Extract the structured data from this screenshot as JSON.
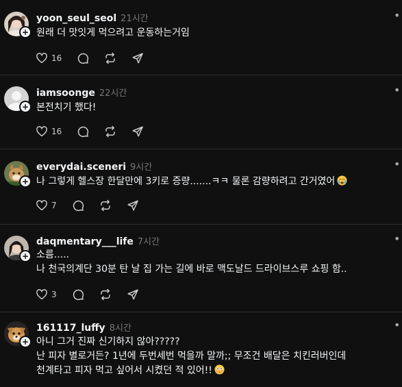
{
  "posts": [
    {
      "username": "yoon_seul_seol",
      "time": "21시간",
      "lines": [
        "원래 더 맛잇게 먹으려고 운동하는거임"
      ],
      "like_count": "16",
      "avatar": "profile-photo-icon"
    },
    {
      "username": "iamsoonge",
      "time": "22시간",
      "lines": [
        "본전치기 했다!"
      ],
      "like_count": "16",
      "avatar": "default-profile-icon"
    },
    {
      "username": "everydai.sceneri",
      "time": "9시간",
      "lines": [
        "나 그렇게 헬스장 한달만에 3키로 증량.......ㅋㅋ 물론 감량하려고 간거였어"
      ],
      "like_count": "7",
      "avatar": "profile-photo-icon",
      "emoji": "crying-face-icon"
    },
    {
      "username": "daqmentary___life",
      "time": "7시간",
      "lines": [
        "소름.....",
        "나 천국의계단 30분 탄 날 집 가는 길에 바로 맥도날드 드라이브스루 쇼핑 함.."
      ],
      "like_count": "3",
      "avatar": "profile-photo-icon"
    },
    {
      "username": "161117_luffy",
      "time": "8시간",
      "lines": [
        "아니 그거 진짜 신기하지 않아?????",
        "난 피자 별로거든? 1년에 두번세번 먹을까 말까;; 무조건 배달은 치킨러버인데",
        "천계타고 피자 먹고 싶어서 시켰던 적 있어!!"
      ],
      "avatar": "profile-photo-icon",
      "emoji": "flushed-face-icon"
    }
  ],
  "colors": {
    "background": "#101010",
    "text": "#f3f5f7",
    "muted": "#777777",
    "divider": "#2e2e2e"
  }
}
